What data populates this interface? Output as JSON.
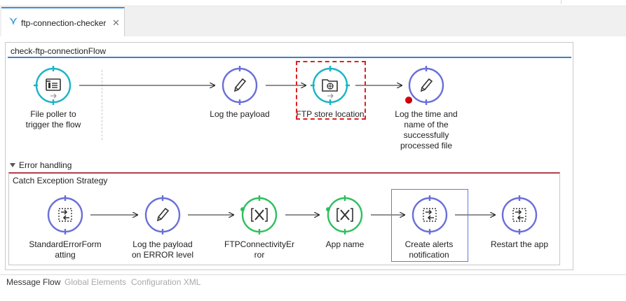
{
  "editor_tab": {
    "label": "ftp-connection-checker",
    "close": "✕"
  },
  "flow": {
    "title": "check-ftp-connectionFlow",
    "nodes": [
      {
        "label": "File poller to\ntrigger the flow",
        "icon": "file-poller-icon"
      },
      {
        "label": "Log the payload",
        "icon": "pencil-icon"
      },
      {
        "label": "FTP store location",
        "icon": "ftp-icon"
      },
      {
        "label": "Log the time and\nname of the\nsuccessfully\nprocessed file",
        "icon": "pencil-icon"
      }
    ]
  },
  "error_handling": {
    "header": "Error handling",
    "strategy_title": "Catch Exception Strategy",
    "nodes": [
      {
        "label": "StandardErrorForm\natting",
        "icon": "transform-icon"
      },
      {
        "label": "Log the payload\non ERROR level",
        "icon": "pencil-icon"
      },
      {
        "label": "FTPConnectivityEr\nror",
        "icon": "x-box-icon"
      },
      {
        "label": "App name",
        "icon": "x-box-icon"
      },
      {
        "label": "Create alerts\nnotification",
        "icon": "transform-icon"
      },
      {
        "label": "Restart the app",
        "icon": "transform-icon"
      }
    ]
  },
  "bottom_tabs": [
    "Message Flow",
    "Global Elements",
    "Configuration XML"
  ],
  "colors": {
    "accent_blue": "#3d80c8",
    "node_purple": "#6a6fd8",
    "node_teal": "#19b4c6",
    "node_green": "#2fbf5e",
    "error_red": "#b0424d"
  }
}
